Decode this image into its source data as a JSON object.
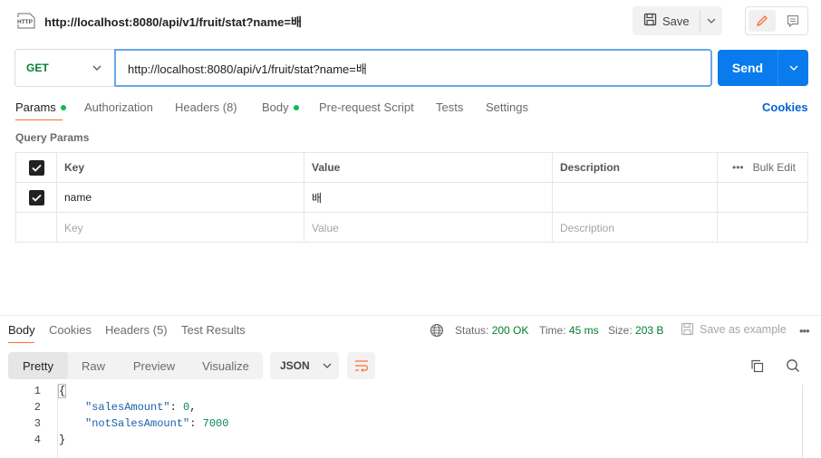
{
  "request": {
    "title": "http://localhost:8080/api/v1/fruit/stat?name=배",
    "method": "GET",
    "url": "http://localhost:8080/api/v1/fruit/stat?name=배",
    "save_label": "Save",
    "send_label": "Send"
  },
  "request_tabs": [
    {
      "label": "Params"
    },
    {
      "label": "Authorization"
    },
    {
      "label": "Headers (8)"
    },
    {
      "label": "Body"
    },
    {
      "label": "Pre-request Script"
    },
    {
      "label": "Tests"
    },
    {
      "label": "Settings"
    }
  ],
  "cookies_label": "Cookies",
  "query_params": {
    "title": "Query Params",
    "headers": {
      "key": "Key",
      "value": "Value",
      "description": "Description",
      "bulk_edit": "Bulk Edit"
    },
    "rows": [
      {
        "key": "name",
        "value": "배",
        "description": ""
      }
    ],
    "placeholders": {
      "key": "Key",
      "value": "Value",
      "description": "Description"
    }
  },
  "response_tabs": [
    {
      "label": "Body"
    },
    {
      "label": "Cookies"
    },
    {
      "label": "Headers (5)"
    },
    {
      "label": "Test Results"
    }
  ],
  "response_meta": {
    "status_label": "Status:",
    "status_value": "200 OK",
    "time_label": "Time:",
    "time_value": "45 ms",
    "size_label": "Size:",
    "size_value": "203 B",
    "save_example": "Save as example"
  },
  "view_modes": [
    {
      "label": "Pretty"
    },
    {
      "label": "Raw"
    },
    {
      "label": "Preview"
    },
    {
      "label": "Visualize"
    }
  ],
  "format": "JSON",
  "response_body": {
    "lines": [
      "1",
      "2",
      "3",
      "4"
    ],
    "open_brace": "{",
    "close_brace": "}",
    "fields": [
      {
        "key": "\"salesAmount\"",
        "value": "0",
        "suffix": ","
      },
      {
        "key": "\"notSalesAmount\"",
        "value": "7000",
        "suffix": ""
      }
    ]
  },
  "colors": {
    "send_blue": "#097bed",
    "method_green": "#007f31",
    "accent_orange": "#ff6c37",
    "link_blue": "#0265d2"
  }
}
